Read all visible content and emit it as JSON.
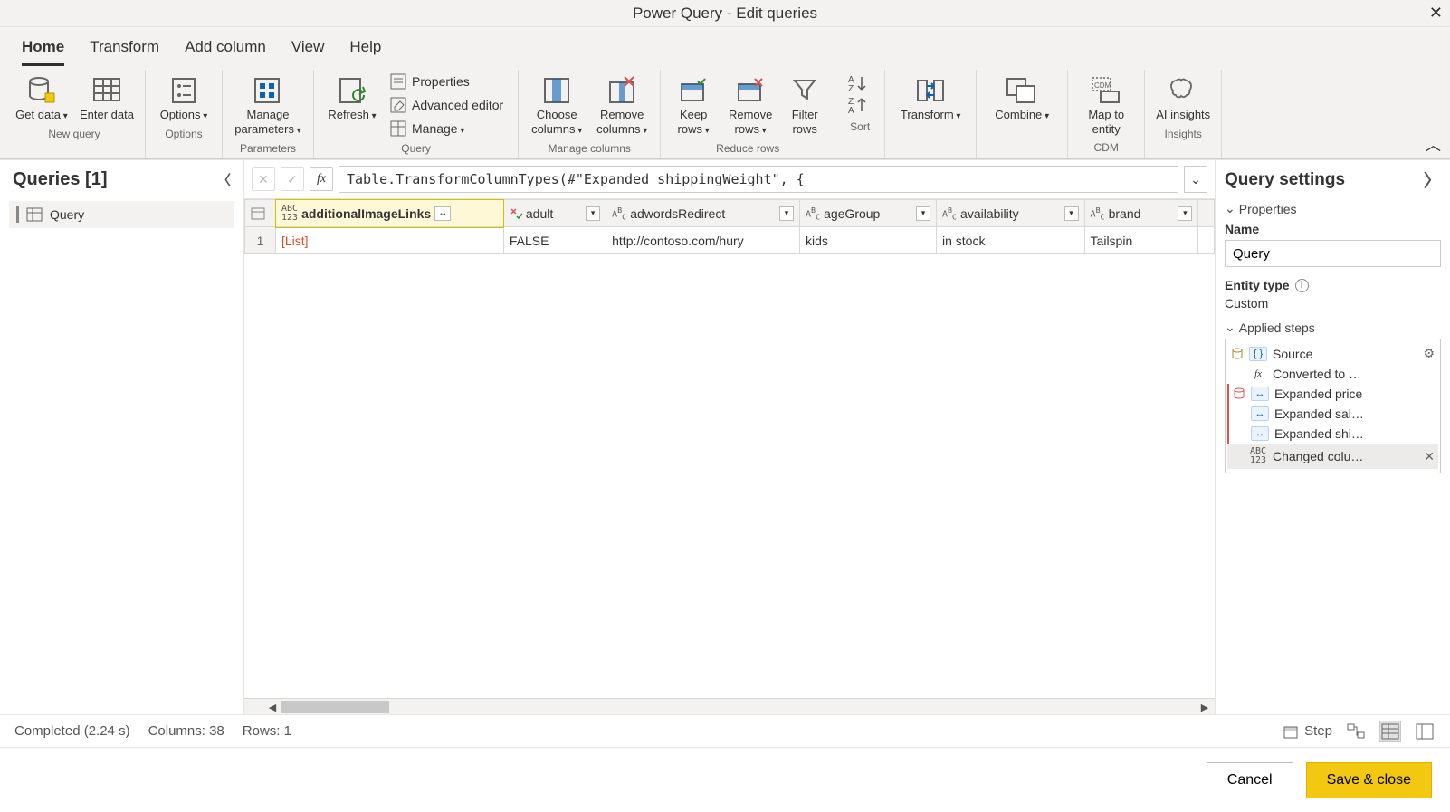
{
  "window": {
    "title": "Power Query - Edit queries"
  },
  "tabs": [
    "Home",
    "Transform",
    "Add column",
    "View",
    "Help"
  ],
  "active_tab": 0,
  "ribbon": {
    "group_new_query": {
      "label": "New query",
      "get_data": "Get data",
      "enter_data": "Enter data"
    },
    "group_options": {
      "label": "Options",
      "options": "Options"
    },
    "group_parameters": {
      "label": "Parameters",
      "manage": "Manage parameters"
    },
    "group_query": {
      "label": "Query",
      "refresh": "Refresh",
      "properties": "Properties",
      "advanced": "Advanced editor",
      "manage": "Manage"
    },
    "group_manage_cols": {
      "label": "Manage columns",
      "choose": "Choose columns",
      "remove": "Remove columns"
    },
    "group_reduce": {
      "label": "Reduce rows",
      "keep": "Keep rows",
      "remove": "Remove rows",
      "filter": "Filter rows"
    },
    "group_sort": {
      "label": "Sort"
    },
    "group_transform": {
      "label": "Transform",
      "transform": "Transform"
    },
    "group_combine": {
      "label": "Combine",
      "combine": "Combine"
    },
    "group_cdm": {
      "label": "CDM",
      "map": "Map to entity"
    },
    "group_insights": {
      "label": "Insights",
      "ai": "AI insights"
    }
  },
  "queries_pane": {
    "title": "Queries [1]",
    "items": [
      "Query"
    ]
  },
  "formula": "Table.TransformColumnTypes(#\"Expanded shippingWeight\", {",
  "grid": {
    "columns": [
      {
        "name": "additionalImageLinks",
        "type": "any",
        "selected": true,
        "expand": true
      },
      {
        "name": "adult",
        "type": "bool"
      },
      {
        "name": "adwordsRedirect",
        "type": "text"
      },
      {
        "name": "ageGroup",
        "type": "text"
      },
      {
        "name": "availability",
        "type": "text"
      },
      {
        "name": "brand",
        "type": "text"
      }
    ],
    "rows": [
      {
        "cells": [
          "[List]",
          "FALSE",
          "http://contoso.com/hury",
          "kids",
          "in stock",
          "Tailspin"
        ]
      }
    ]
  },
  "settings": {
    "title": "Query settings",
    "properties_label": "Properties",
    "name_label": "Name",
    "name_value": "Query",
    "entity_label": "Entity type",
    "entity_value": "Custom",
    "applied_label": "Applied steps",
    "steps": [
      {
        "label": "Source",
        "gear": true,
        "gutter": "db",
        "icon": "json"
      },
      {
        "label": "Converted to …",
        "icon": "fx"
      },
      {
        "label": "Expanded price",
        "gutter": "red",
        "icon": "exp"
      },
      {
        "label": "Expanded sal…",
        "icon": "exp"
      },
      {
        "label": "Expanded shi…",
        "icon": "exp"
      },
      {
        "label": "Changed colu…",
        "icon": "abc",
        "selected": true,
        "del": true
      }
    ]
  },
  "statusbar": {
    "completed": "Completed (2.24 s)",
    "columns": "Columns: 38",
    "rows": "Rows: 1",
    "step": "Step"
  },
  "footer": {
    "cancel": "Cancel",
    "save": "Save & close"
  }
}
